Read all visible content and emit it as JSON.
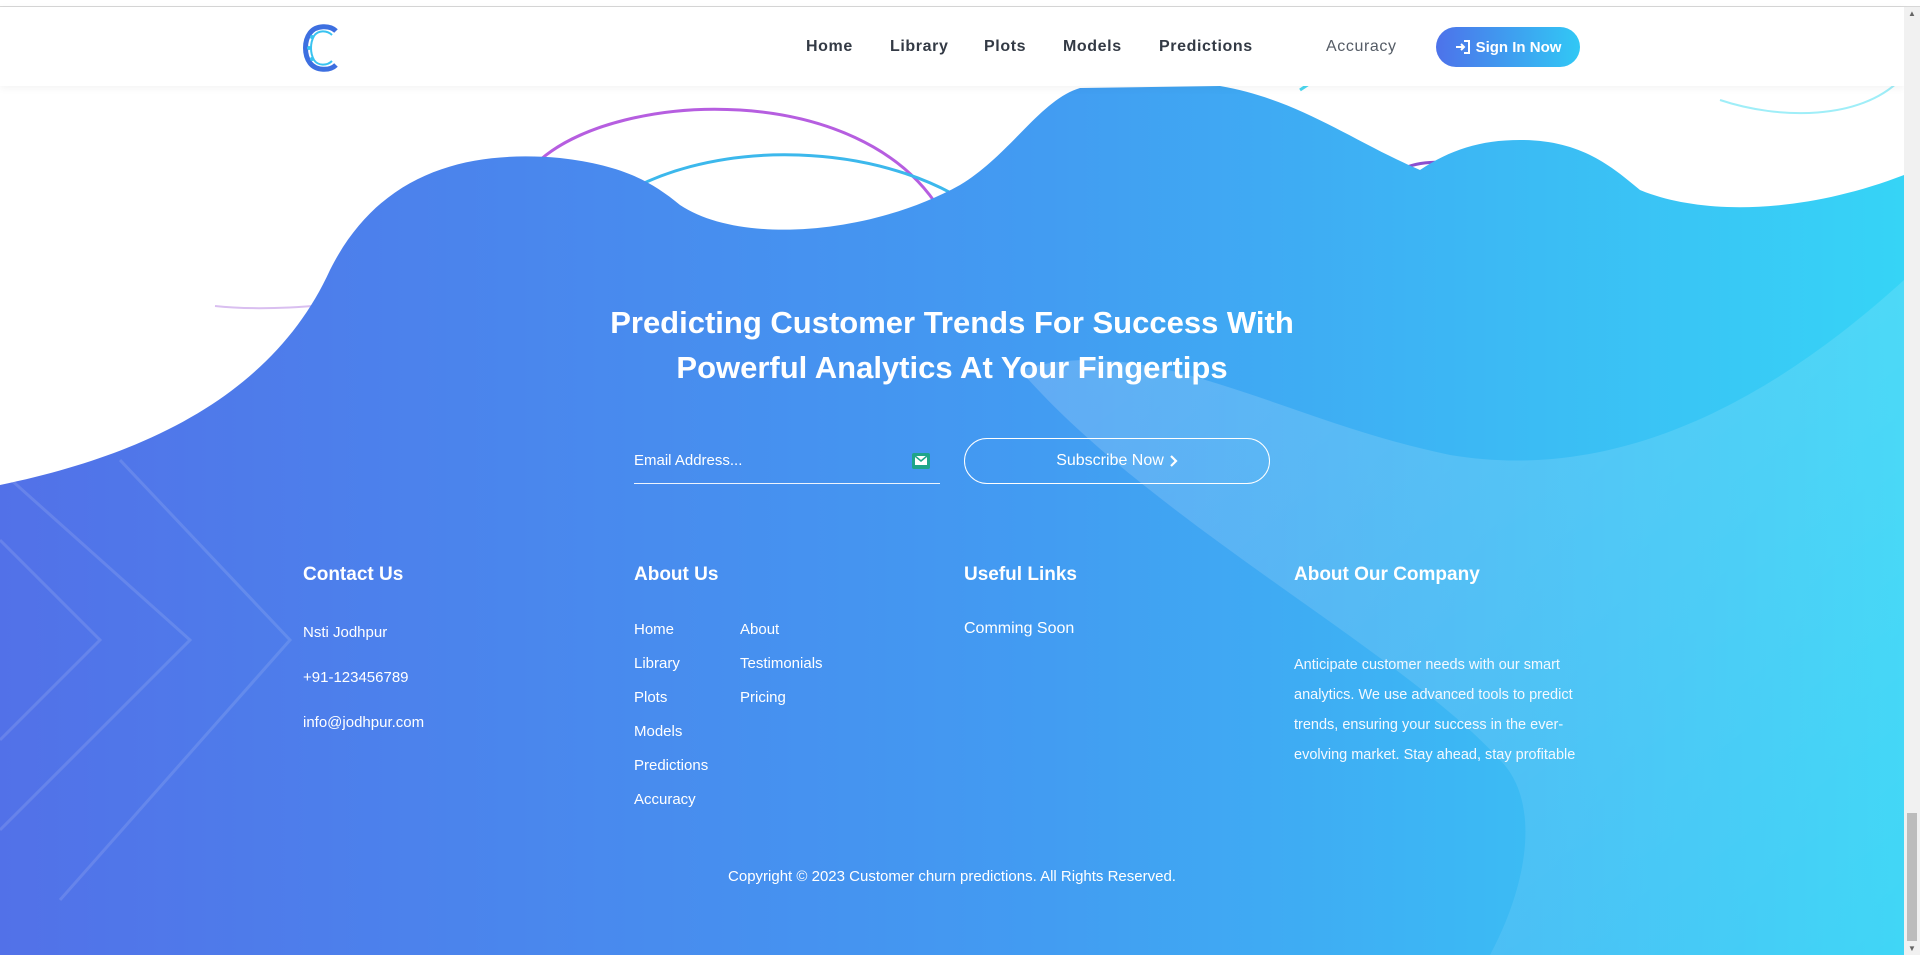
{
  "nav": {
    "items": [
      "Home",
      "Library",
      "Plots",
      "Models",
      "Predictions"
    ],
    "accuracy": "Accuracy",
    "sign_in": "Sign In Now"
  },
  "hero": {
    "headline_line1": "Predicting Customer Trends For Success With",
    "headline_line2": "Powerful Analytics At Your Fingertips"
  },
  "subscribe": {
    "email_placeholder": "Email Address...",
    "button_label": "Subscribe Now",
    "button_icon": "chevron-right-icon"
  },
  "footer": {
    "contact": {
      "title": "Contact Us",
      "address": "Nsti Jodhpur",
      "phone": "+91-123456789",
      "email": "info@jodhpur.com"
    },
    "about": {
      "title": "About Us",
      "col1": [
        "Home",
        "Library",
        "Plots",
        "Models",
        "Predictions",
        "Accuracy"
      ],
      "col2": [
        "About",
        "Testimonials",
        "Pricing"
      ]
    },
    "useful": {
      "title": "Useful Links",
      "item": "Comming Soon"
    },
    "company": {
      "title": "About Our Company",
      "text": "Anticipate customer needs with our smart analytics. We use advanced tools to predict trends, ensuring your success in the ever-evolving market. Stay ahead, stay profitable"
    },
    "copyright": "Copyright © 2023 Customer churn predictions. All Rights Reserved."
  },
  "colors": {
    "gradient_start": "#5271e8",
    "gradient_end": "#36d4f6",
    "button_start": "#4d72ea",
    "button_end": "#31c8f5"
  }
}
